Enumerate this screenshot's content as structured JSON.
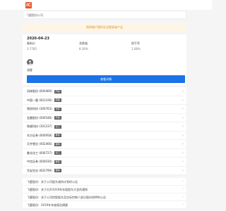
{
  "header": {
    "logo_text": "IC"
  },
  "search": {
    "value": "飞鹿股份公司"
  },
  "notice": {
    "text": "您的账户暂时无法登录该产品"
  },
  "summary": {
    "date": "2020-04-23",
    "metrics": [
      {
        "label": "最新价",
        "value": "3.7785"
      },
      {
        "label": "涨跌幅",
        "value": "8.34%"
      },
      {
        "label": "换手率",
        "value": "1.08%"
      }
    ]
  },
  "user": {
    "name": "游客"
  },
  "primary_button": {
    "label": "查看详情"
  },
  "stocks": [
    {
      "name": "风神股份 (600469)",
      "tag": "汽车"
    },
    {
      "name": "中国一重 (601106)",
      "tag": "机械"
    },
    {
      "name": "锦浪科技 (300763)",
      "tag": "光伏"
    },
    {
      "name": "金圆股份 (000546)",
      "tag": "环保"
    },
    {
      "name": "和顺科技 (301237)",
      "tag": "化工"
    },
    {
      "name": "东方证券 (600958)",
      "tag": "券商"
    },
    {
      "name": "天齐锂业 (002466)",
      "tag": "锂电"
    },
    {
      "name": "鲁北化工 (600727)",
      "tag": "化工"
    },
    {
      "name": "中信证券 (600030)",
      "tag": "券商"
    },
    {
      "name": "华友钴业 (603799)",
      "tag": "锂电"
    }
  ],
  "news": [
    {
      "title": "飞鹿股份：关于公司股东减持计划的公告"
    },
    {
      "title": "飞鹿股份：关于召开2019年年度股东大会的通知"
    },
    {
      "title": "飞鹿股份：关于公司控股股东及实际控制人部分股份质押的公告"
    },
    {
      "title": "飞鹿股份：2019年年度报告摘要"
    }
  ]
}
